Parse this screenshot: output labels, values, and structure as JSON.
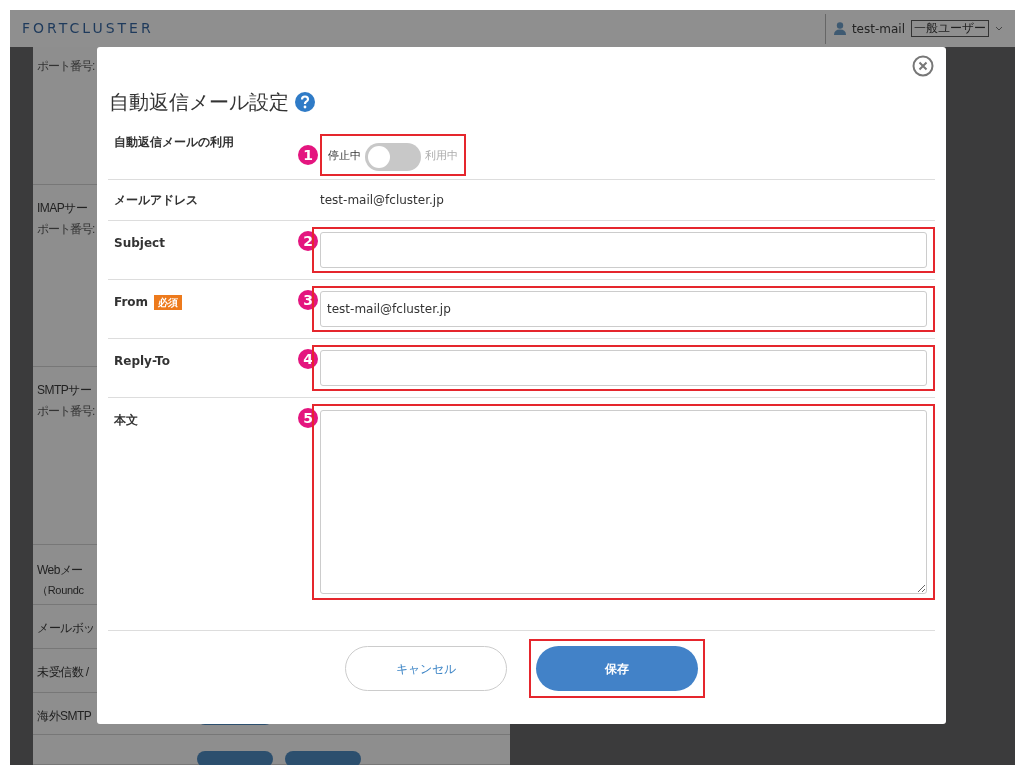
{
  "header": {
    "logo": "FORTCLUSTER",
    "user": "test-mail",
    "role": "一般ユーザー"
  },
  "background_rows": [
    {
      "title": "",
      "sub": "ポート番号:"
    },
    {
      "title": "IMAPサー",
      "sub": "ポート番号:"
    },
    {
      "title": "SMTPサー",
      "sub": "ポート番号:"
    },
    {
      "title": "Webメー",
      "sub": "（Roundc"
    },
    {
      "title": "メールボッ",
      "sub": ""
    },
    {
      "title": "未受信数 /",
      "sub": ""
    },
    {
      "title": "海外SMTP",
      "sub": ""
    },
    {
      "title": "",
      "sub": ""
    }
  ],
  "dialog": {
    "title": "自動返信メール設定",
    "rows": [
      {
        "kind": "toggle",
        "label": "自動返信メールの利用",
        "marker": "1",
        "off_label": "停止中",
        "on_label": "利用中",
        "on": false
      },
      {
        "kind": "text",
        "label": "メールアドレス",
        "value": "test-mail@fcluster.jp"
      },
      {
        "kind": "input",
        "label": "Subject",
        "marker": "2",
        "value": ""
      },
      {
        "kind": "input",
        "label": "From",
        "required": "必須",
        "marker": "3",
        "value": "test-mail@fcluster.jp"
      },
      {
        "kind": "input",
        "label": "Reply-To",
        "marker": "4",
        "value": ""
      },
      {
        "kind": "textarea",
        "label": "本文",
        "marker": "5",
        "value": ""
      }
    ],
    "buttons": [
      {
        "kind": "secondary",
        "label": "キャンセル",
        "highlighted": false
      },
      {
        "kind": "primary",
        "label": "保存",
        "highlighted": true
      }
    ]
  }
}
